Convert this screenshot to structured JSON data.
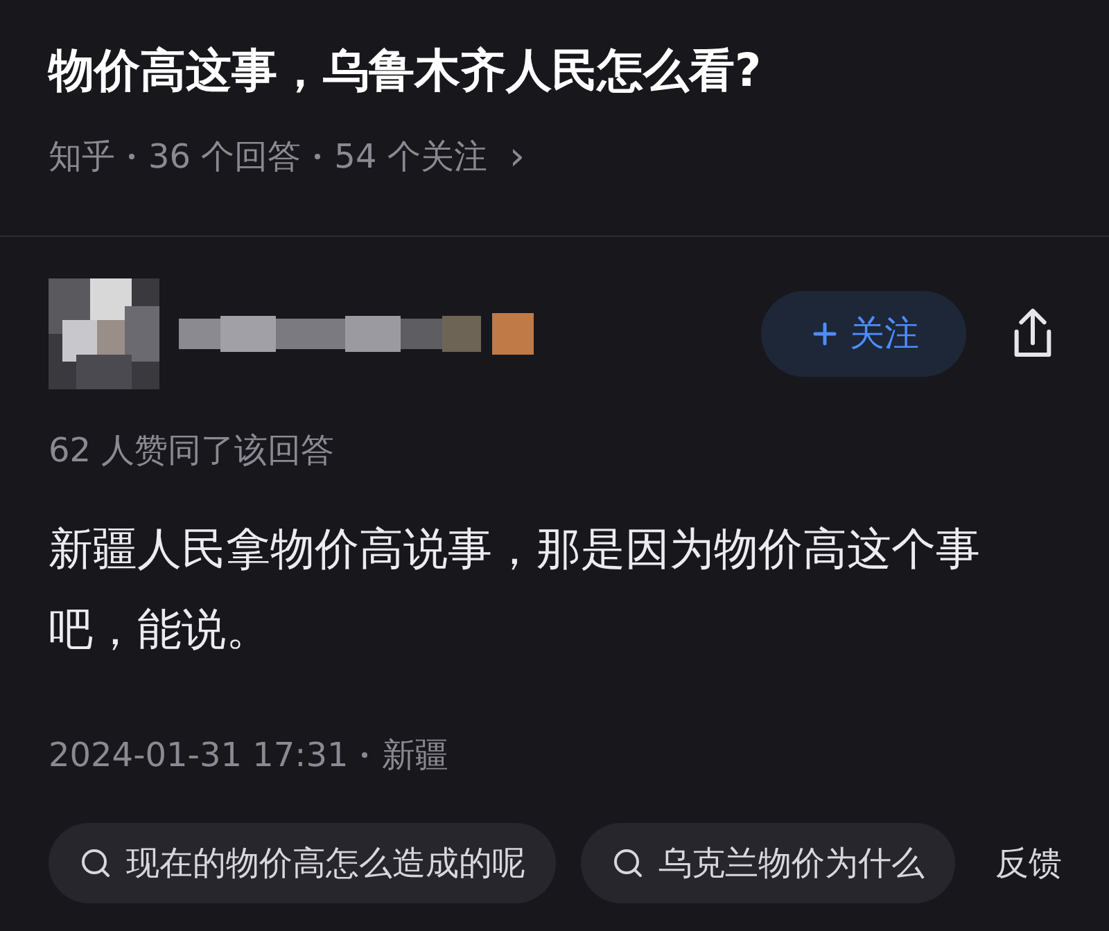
{
  "question": {
    "title": "物价高这事，乌鲁木齐人民怎么看?",
    "source": "知乎",
    "answers": "36 个回答",
    "followers": "54 个关注",
    "chevron": "›"
  },
  "answer": {
    "follow_button": "关注",
    "upvotes": "62 人赞同了该回答",
    "body": "新疆人民拿物价高说事，那是因为物价高这个事吧，能说。",
    "date": "2024-01-31 17:31",
    "location": "新疆"
  },
  "suggestions": [
    {
      "text": "现在的物价高怎么造成的呢"
    },
    {
      "text": "乌克兰物价为什么"
    }
  ],
  "feedback": "反馈"
}
